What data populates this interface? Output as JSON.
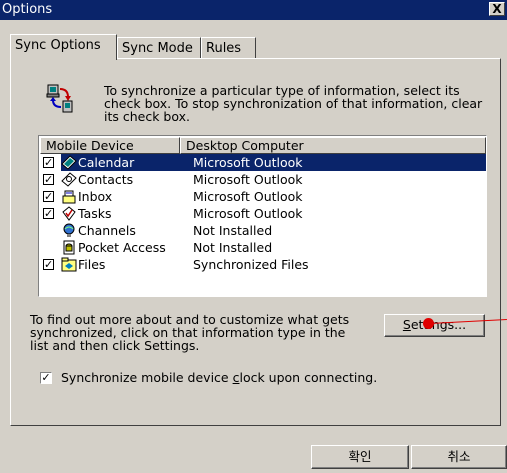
{
  "window": {
    "title": "Options",
    "close_glyph": "X"
  },
  "tabs": [
    {
      "label": "Sync Options",
      "active": true
    },
    {
      "label": "Sync Mode",
      "active": false
    },
    {
      "label": "Rules",
      "active": false
    }
  ],
  "intro": {
    "icon": "sync-arrows-icon",
    "text": "To synchronize a particular type of information, select its check box. To stop synchronization of that information, clear its check box."
  },
  "list": {
    "headers": [
      "Mobile Device",
      "Desktop Computer"
    ],
    "rows": [
      {
        "checked": true,
        "icon": "calendar-icon",
        "device": "Calendar",
        "desktop": "Microsoft Outlook",
        "selected": true
      },
      {
        "checked": true,
        "icon": "contacts-icon",
        "device": "Contacts",
        "desktop": "Microsoft Outlook",
        "selected": false
      },
      {
        "checked": true,
        "icon": "inbox-icon",
        "device": "Inbox",
        "desktop": "Microsoft Outlook",
        "selected": false
      },
      {
        "checked": true,
        "icon": "tasks-icon",
        "device": "Tasks",
        "desktop": "Microsoft Outlook",
        "selected": false
      },
      {
        "checked": false,
        "icon": "channels-icon",
        "device": "Channels",
        "desktop": "Not Installed",
        "selected": false
      },
      {
        "checked": false,
        "icon": "pocket-access-icon",
        "device": "Pocket Access",
        "desktop": "Not Installed",
        "selected": false
      },
      {
        "checked": true,
        "icon": "files-icon",
        "device": "Files",
        "desktop": "Synchronized Files",
        "selected": false
      }
    ]
  },
  "info": {
    "text": "To find out more about and to customize what gets synchronized, click on that information type in the list and then click Settings."
  },
  "settings_button": {
    "label_prefix": "S",
    "label_rest": "ettings..."
  },
  "clock": {
    "checked": true,
    "label_before": "Synchronize mobile device ",
    "label_accel": "c",
    "label_after": "lock upon connecting."
  },
  "buttons": {
    "ok": "확인",
    "cancel": "취소"
  },
  "colors": {
    "face": "#d4d0c8",
    "titlebar": "#0a246a",
    "selection": "#0a246a",
    "annotation": "#e00000"
  }
}
